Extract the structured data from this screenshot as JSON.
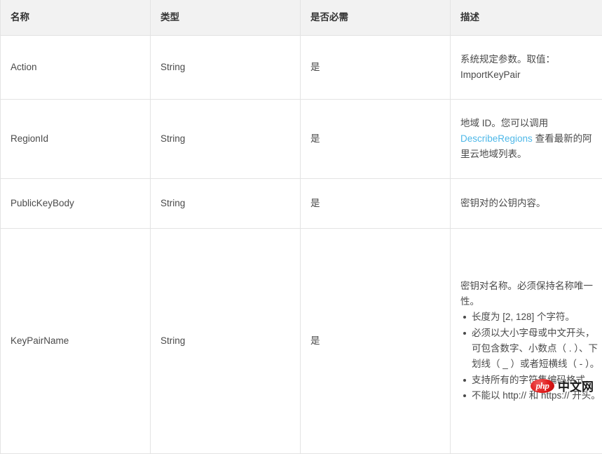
{
  "table": {
    "headers": [
      {
        "label": "名称"
      },
      {
        "label": "类型"
      },
      {
        "label": "是否必需"
      },
      {
        "label": "描述"
      }
    ],
    "rows": [
      {
        "name": "Action",
        "type": "String",
        "required": "是",
        "description": {
          "intro": "系统规定参数。取值：ImportKeyPair"
        }
      },
      {
        "name": "RegionId",
        "type": "String",
        "required": "是",
        "description": {
          "before_link": "地域 ID。您可以调用 ",
          "link_text": "DescribeRegions",
          "after_link": " 查看最新的阿里云地域列表。"
        }
      },
      {
        "name": "PublicKeyBody",
        "type": "String",
        "required": "是",
        "description": {
          "intro": "密钥对的公钥内容。"
        }
      },
      {
        "name": "KeyPairName",
        "type": "String",
        "required": "是",
        "description": {
          "intro": "密钥对名称。必须保持名称唯一性。",
          "bullets": [
            "长度为 [2, 128] 个字符。",
            "必须以大小字母或中文开头，可包含数字、小数点（ . ）、下划线（ _ ）或者短横线（ - ）。",
            "支持所有的字符集编码格式。",
            "不能以 http:// 和 https:// 开头。"
          ]
        }
      }
    ]
  },
  "watermark": {
    "badge_label": "php",
    "site_label": "中文网"
  },
  "colors": {
    "header_background": "#f2f2f2",
    "border": "#e3e3e3",
    "text": "#4a4a4a",
    "link": "#4eb8e8",
    "watermark_red": "#e01b1b"
  }
}
